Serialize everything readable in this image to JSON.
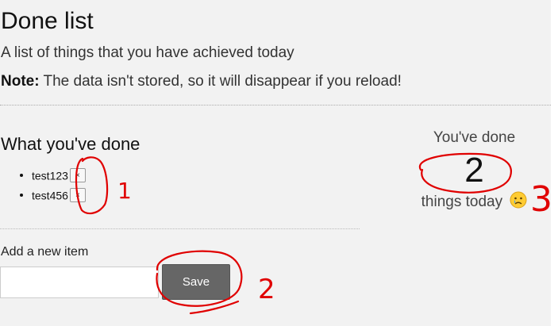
{
  "header": {
    "title": "Done list",
    "subtitle": "A list of things that you have achieved today",
    "note_label": "Note:",
    "note_text": " The data isn't stored, so it will disappear if you reload!"
  },
  "done_section": {
    "heading": "What you've done",
    "items": [
      {
        "text": "test123",
        "remove_label": "×"
      },
      {
        "text": "test456",
        "remove_label": "×"
      }
    ]
  },
  "add_form": {
    "label": "Add a new item",
    "input_value": "",
    "save_label": "Save"
  },
  "stats": {
    "prefix": "You've done",
    "count": "2",
    "suffix": "things today",
    "emoji_icon": "crying-face-icon"
  },
  "annotations": {
    "color": "#e00000",
    "labels": [
      "1",
      "2",
      "3"
    ]
  },
  "colors": {
    "background": "#f2f2f2",
    "save_button": "#666666"
  }
}
